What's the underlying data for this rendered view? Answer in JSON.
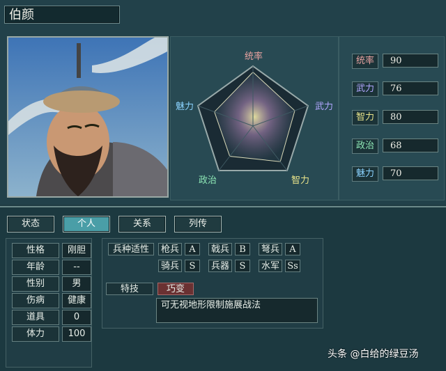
{
  "character": {
    "name": "伯颜"
  },
  "radar": {
    "labels": [
      "统率",
      "武力",
      "智力",
      "政治",
      "魅力"
    ],
    "values": [
      90,
      76,
      80,
      68,
      70
    ],
    "colors": {
      "tong": "#e9a3a1",
      "wu": "#b1a7ff",
      "zhi": "#e9e48a",
      "zheng": "#8ee8b6",
      "mei": "#8bd3ff"
    }
  },
  "stats": [
    {
      "label": "统率",
      "value": "90"
    },
    {
      "label": "武力",
      "value": "76"
    },
    {
      "label": "智力",
      "value": "80"
    },
    {
      "label": "政治",
      "value": "68"
    },
    {
      "label": "魅力",
      "value": "70"
    }
  ],
  "tabs": [
    {
      "label": "状态",
      "active": false
    },
    {
      "label": "个人",
      "active": true
    },
    {
      "label": "关系",
      "active": false
    },
    {
      "label": "列传",
      "active": false
    }
  ],
  "personal": [
    {
      "label": "性格",
      "value": "刚胆"
    },
    {
      "label": "年龄",
      "value": "--"
    },
    {
      "label": "性别",
      "value": "男"
    },
    {
      "label": "伤病",
      "value": "健康"
    },
    {
      "label": "道具",
      "value": "0"
    },
    {
      "label": "体力",
      "value": "100"
    }
  ],
  "aptitude": {
    "title": "兵种适性",
    "rows": [
      [
        {
          "label": "枪兵",
          "value": "A"
        },
        {
          "label": "戟兵",
          "value": "B"
        },
        {
          "label": "弩兵",
          "value": "A"
        }
      ],
      [
        {
          "label": "骑兵",
          "value": "S"
        },
        {
          "label": "兵器",
          "value": "S"
        },
        {
          "label": "水军",
          "value": "Ss"
        }
      ]
    ]
  },
  "skill": {
    "label": "特技",
    "name": "巧变",
    "description": "可无视地形限制施展战法"
  },
  "watermark": "头条 @白给的绿豆汤"
}
